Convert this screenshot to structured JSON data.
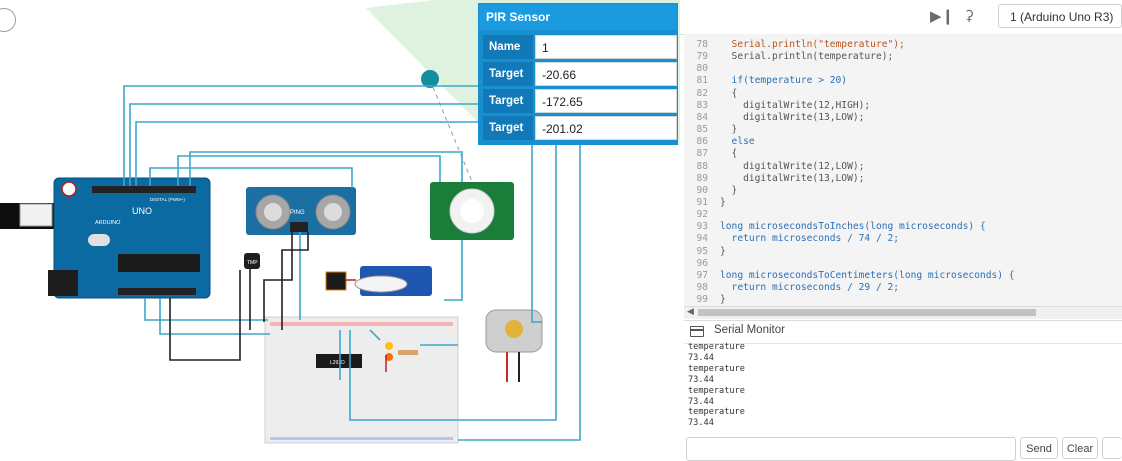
{
  "pir_panel": {
    "title": "PIR Sensor",
    "fields": [
      {
        "label": "Name",
        "value": "1"
      },
      {
        "label": "Target X",
        "value": "-20.66"
      },
      {
        "label": "Target Y",
        "value": "-172.65"
      },
      {
        "label": "Target Y",
        "value": "-201.02"
      }
    ]
  },
  "toolbar": {
    "board_select": "1 (Arduino Uno R3)",
    "step_icon": "step-forward-icon",
    "debug_icon": "debug-icon"
  },
  "code": {
    "lines": [
      {
        "n": "78",
        "t": "  Serial.println(\"temperature\");"
      },
      {
        "n": "79",
        "t": "  Serial.println(temperature);"
      },
      {
        "n": "80",
        "t": ""
      },
      {
        "n": "81",
        "t": "  if(temperature > 20)"
      },
      {
        "n": "82",
        "t": "  {"
      },
      {
        "n": "83",
        "t": "    digitalWrite(12,HIGH);"
      },
      {
        "n": "84",
        "t": "    digitalWrite(13,LOW);"
      },
      {
        "n": "85",
        "t": "  }"
      },
      {
        "n": "86",
        "t": "  else"
      },
      {
        "n": "87",
        "t": "  {"
      },
      {
        "n": "88",
        "t": "    digitalWrite(12,LOW);"
      },
      {
        "n": "89",
        "t": "    digitalWrite(13,LOW);"
      },
      {
        "n": "90",
        "t": "  }"
      },
      {
        "n": "91",
        "t": "}"
      },
      {
        "n": "92",
        "t": ""
      },
      {
        "n": "93",
        "t": "long microsecondsToInches(long microseconds) {"
      },
      {
        "n": "94",
        "t": "  return microseconds / 74 / 2;"
      },
      {
        "n": "95",
        "t": "}"
      },
      {
        "n": "96",
        "t": ""
      },
      {
        "n": "97",
        "t": "long microsecondsToCentimeters(long microseconds) {"
      },
      {
        "n": "98",
        "t": "  return microseconds / 29 / 2;"
      },
      {
        "n": "99",
        "t": "}"
      }
    ]
  },
  "serial_monitor": {
    "title": "Serial Monitor",
    "output": [
      "temperature",
      "73.44",
      "temperature",
      "73.44",
      "temperature",
      "73.44",
      "temperature",
      "73.44"
    ],
    "send_label": "Send",
    "clear_label": "Clear"
  },
  "circuit": {
    "board_label": "UNO",
    "brand_label": "ARDUINO",
    "digital_label": "DIGITAL (PWM~)",
    "sensor_label": "TMP",
    "ping_label": "PING",
    "chip_label": "L293D"
  },
  "colors": {
    "panel_blue": "#1a8fd0",
    "arduino_blue": "#0b6aa1",
    "wire_blue": "#3fa7c9",
    "wire_black": "#222222",
    "wire_red": "#c62828",
    "pir_green": "#1a7d3a",
    "teal_point": "#0f8fa0"
  }
}
